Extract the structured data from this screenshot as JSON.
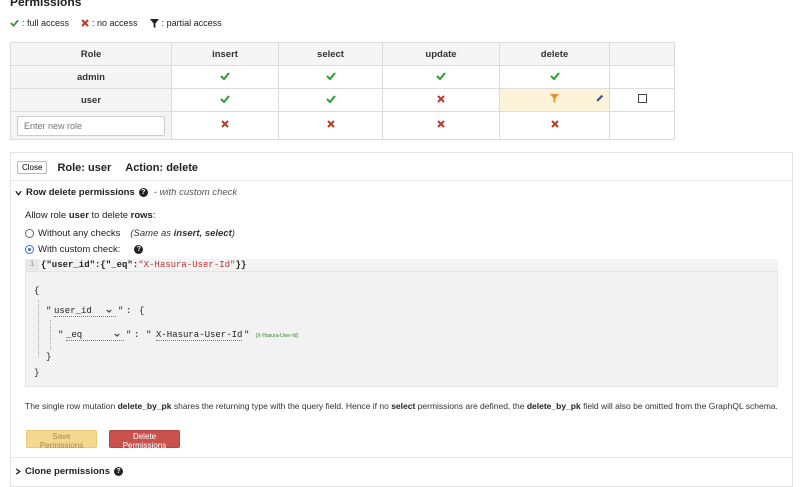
{
  "header": {
    "title": "Permissions"
  },
  "legend": {
    "full": ": full access",
    "none": ": no access",
    "partial": ": partial access"
  },
  "table": {
    "headers": [
      "Role",
      "insert",
      "select",
      "update",
      "delete"
    ],
    "rows": [
      {
        "role": "admin",
        "insert": "check",
        "select": "check",
        "update": "check",
        "delete": "check"
      },
      {
        "role": "user",
        "insert": "check",
        "select": "check",
        "update": "cross",
        "delete": "filter"
      }
    ],
    "new_role_placeholder": "Enter new role",
    "new_role_row": {
      "insert": "cross",
      "select": "cross",
      "update": "cross",
      "delete": "cross"
    }
  },
  "panel": {
    "close_label": "Close",
    "role_label": "Role: user",
    "action_label": "Action: delete",
    "row_section": {
      "title": "Row delete permissions",
      "note": "- with custom check"
    },
    "allow_prefix": "Allow role ",
    "allow_role": "user",
    "allow_middle": " to delete ",
    "allow_obj": "rows",
    "allow_suffix": ":",
    "option1": {
      "label": "Without any checks",
      "hint": "(Same as insert, select)",
      "hint_a": "(Same as ",
      "hint_b": "insert, select",
      "hint_c": ")"
    },
    "option2": {
      "label": "With custom check:"
    },
    "editor": {
      "line_number": "1",
      "code_a": "{\"user_id\":{\"_eq\":",
      "code_str": "\"X-Hasura-User-Id\"",
      "code_b": "}}"
    },
    "builder": {
      "open_brace": "{",
      "close_brace": "}",
      "quote": "\"",
      "colon": ":",
      "column": "user_id",
      "operator": "_eq",
      "value": "X-Hasura-User-Id",
      "session_link": "[X-Hasura-User-Id]"
    },
    "info": {
      "t1": "The single row mutation ",
      "b1": "delete_by_pk",
      "t2": " shares the returning type with the query field. Hence if no ",
      "b2": "select",
      "t3": " permissions are defined, the ",
      "b3": "delete_by_pk",
      "t4": " field will also be omitted from the GraphQL schema."
    },
    "save_label": "Save Permissions",
    "delete_label": "Delete Permissions",
    "clone_label": "Clone permissions"
  },
  "colors": {
    "check": "#2e9b2e",
    "cross": "#c0392b",
    "selected_cell": "#fdf3d8",
    "save_bg": "#f5d88f",
    "delete_bg": "#c9524f"
  }
}
